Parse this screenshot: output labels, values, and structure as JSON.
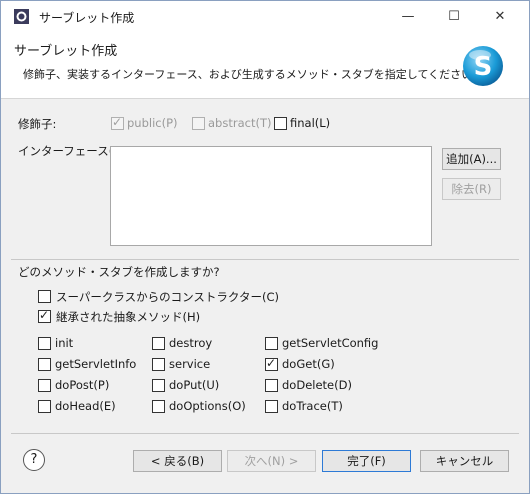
{
  "window": {
    "title": "サーブレット作成",
    "minimize": "—",
    "maximize": "☐",
    "close": "✕"
  },
  "header": {
    "title": "サーブレット作成",
    "message": "修飾子、実装するインターフェース、および生成するメソッド・スタブを指定してください。"
  },
  "modifiers": {
    "label": "修飾子:",
    "public": {
      "label": "public(P)",
      "checked": true,
      "enabled": false
    },
    "abstract": {
      "label": "abstract(T)",
      "checked": false,
      "enabled": false
    },
    "final": {
      "label": "final(L)",
      "checked": false,
      "enabled": true
    }
  },
  "interfaces": {
    "label": "インターフェース(I):",
    "add_button": "追加(A)...",
    "remove_button": "除去(R)"
  },
  "stubs": {
    "question": "どのメソッド・スタブを作成しますか?",
    "superclass_constructors": {
      "label": "スーパークラスからのコンストラクター(C)",
      "checked": false
    },
    "inherited_abstract": {
      "label": "継承された抽象メソッド(H)",
      "checked": true
    },
    "methods": [
      {
        "label": "init",
        "checked": false
      },
      {
        "label": "destroy",
        "checked": false
      },
      {
        "label": "getServletConfig",
        "checked": false
      },
      {
        "label": "getServletInfo",
        "checked": false
      },
      {
        "label": "service",
        "checked": false
      },
      {
        "label": "doGet(G)",
        "checked": true
      },
      {
        "label": "doPost(P)",
        "checked": false
      },
      {
        "label": "doPut(U)",
        "checked": false
      },
      {
        "label": "doDelete(D)",
        "checked": false
      },
      {
        "label": "doHead(E)",
        "checked": false
      },
      {
        "label": "doOptions(O)",
        "checked": false
      },
      {
        "label": "doTrace(T)",
        "checked": false
      }
    ]
  },
  "footer": {
    "help": "?",
    "back": "< 戻る(B)",
    "next": "次へ(N) >",
    "finish": "完了(F)",
    "cancel": "キャンセル"
  },
  "colors": {
    "accent": "#2d7ad6",
    "logo": "#1a9bd7"
  }
}
